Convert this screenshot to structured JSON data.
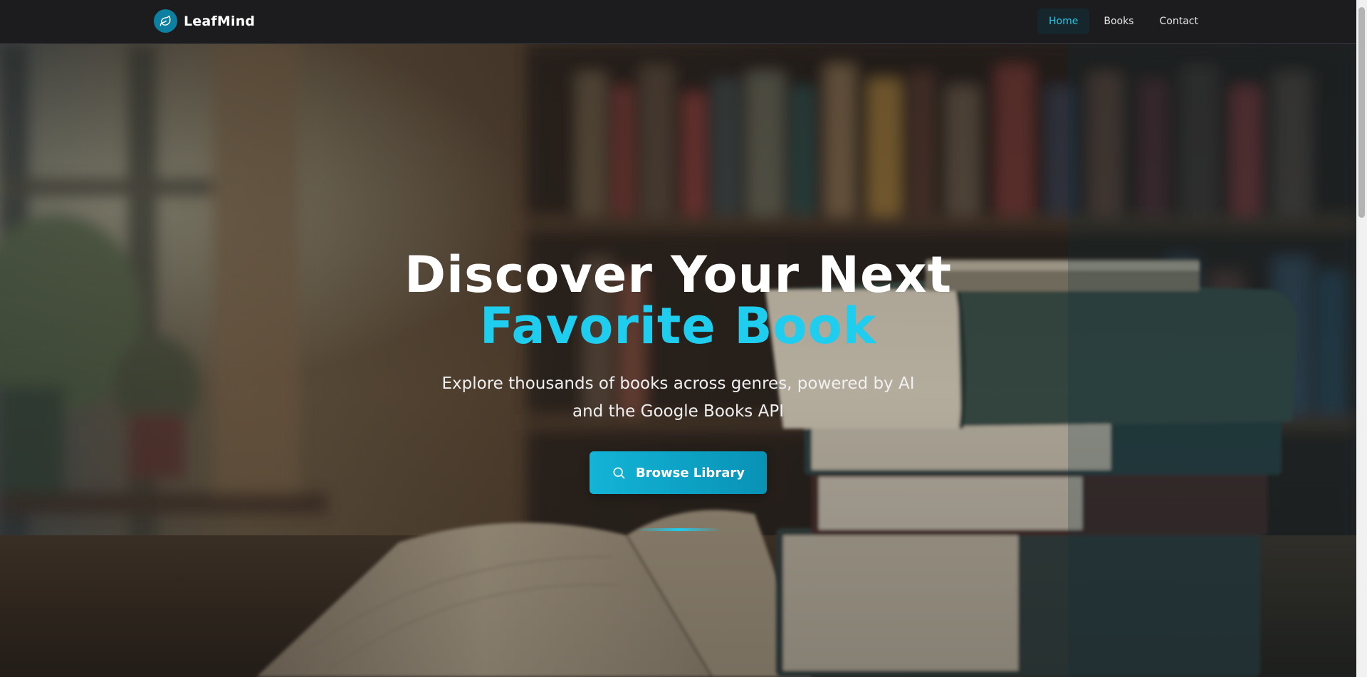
{
  "brand": {
    "name": "LeafMind",
    "logo_icon": "leaf-icon",
    "logo_color": "#0d7fa0"
  },
  "nav": {
    "items": [
      {
        "label": "Home",
        "active": true
      },
      {
        "label": "Books",
        "active": false
      },
      {
        "label": "Contact",
        "active": false
      }
    ]
  },
  "hero": {
    "title_line1": "Discover Your Next",
    "title_line2": "Favorite Book",
    "subtitle": "Explore thousands of books across genres, powered by AI and the Google Books API",
    "cta": {
      "label": "Browse Library",
      "icon": "search-icon"
    },
    "background": "library-bookshelf-photo"
  },
  "colors": {
    "accent": "#1fcdef",
    "navbar_bg": "#1c1c1f",
    "nav_active_bg": "#16262d",
    "nav_active_text": "#26c6e6",
    "button_start": "#13b4d6",
    "button_end": "#0892b6"
  }
}
